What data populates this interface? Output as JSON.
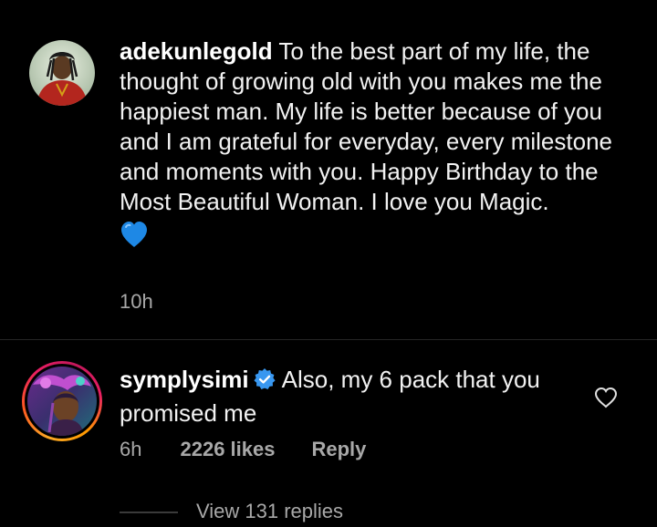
{
  "post": {
    "author": "adekunlegold",
    "caption_text": "To the best part of my life, the thought of growing old with you makes me the happiest man. My life is better because of you and I am grateful for everyday, every milestone and moments with you. Happy Birthday to the Most Beautiful Woman. I love you Magic.",
    "emoji_icon": "blue-heart-icon",
    "time": "10h"
  },
  "comment": {
    "author": "symplysimi",
    "verified_icon": "verified-badge-icon",
    "text": "Also, my 6 pack that you promised me",
    "time": "6h",
    "likes": "2226 likes",
    "reply_label": "Reply",
    "like_icon": "heart-outline-icon"
  },
  "replies": {
    "label": "View 131 replies"
  },
  "colors": {
    "background": "#000000",
    "text": "#f2f2f2",
    "secondary_text": "#a8a8a8",
    "verified_blue": "#3897f0",
    "heart_blue": "#1e88e5",
    "story_ring": "#e91e63"
  }
}
